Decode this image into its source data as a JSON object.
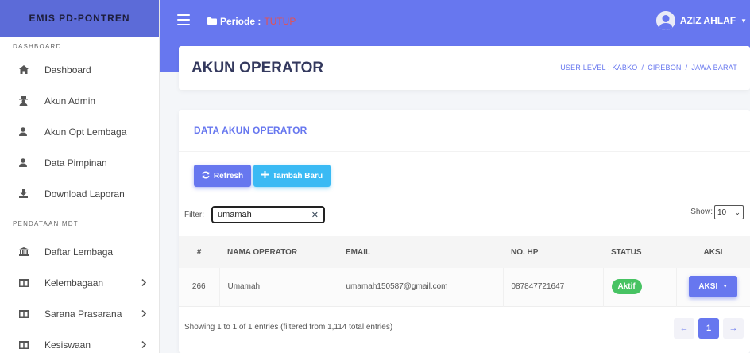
{
  "sidebar": {
    "brand": "EMIS PD-PONTREN",
    "header_dashboard": "DASHBOARD",
    "header_pendataan": "PENDATAAN MDT",
    "items": [
      {
        "label": "Dashboard",
        "icon": "home-icon"
      },
      {
        "label": "Akun Admin",
        "icon": "user-secret-icon"
      },
      {
        "label": "Akun Opt Lembaga",
        "icon": "user-icon"
      },
      {
        "label": "Data Pimpinan",
        "icon": "user-icon"
      },
      {
        "label": "Download Laporan",
        "icon": "download-icon"
      },
      {
        "label": "Daftar Lembaga",
        "icon": "institution-icon"
      },
      {
        "label": "Kelembagaan",
        "icon": "columns-icon"
      },
      {
        "label": "Sarana Prasarana",
        "icon": "columns-icon"
      },
      {
        "label": "Kesiswaan",
        "icon": "columns-icon"
      }
    ]
  },
  "topbar": {
    "periode_label": "Periode :",
    "periode_value": "TUTUP",
    "user_name": "AZIZ AHLAF"
  },
  "page_header": {
    "title": "AKUN OPERATOR",
    "breadcrumb": [
      "USER LEVEL : KABKO",
      "CIREBON",
      "JAWA BARAT"
    ]
  },
  "card": {
    "title": "DATA AKUN OPERATOR",
    "refresh_label": "Refresh",
    "add_label": "Tambah Baru",
    "filter_label": "Filter:",
    "filter_value": "umamah",
    "show_label": "Show:",
    "show_value": "10",
    "columns": [
      "#",
      "NAMA OPERATOR",
      "EMAIL",
      "NO. HP",
      "STATUS",
      "AKSI"
    ],
    "rows": [
      {
        "no": "266",
        "nama": "Umamah",
        "email": "umamah150587@gmail.com",
        "hp": "087847721647",
        "status": "Aktif",
        "aksi": "AKSI"
      }
    ],
    "info": "Showing 1 to 1 of 1 entries (filtered from 1,114 total entries)",
    "pager": {
      "prev": "←",
      "page": "1",
      "next": "→"
    }
  },
  "colors": {
    "primary": "#6777ef",
    "info": "#3abaf4",
    "success": "#47c363",
    "danger": "#e45151"
  }
}
